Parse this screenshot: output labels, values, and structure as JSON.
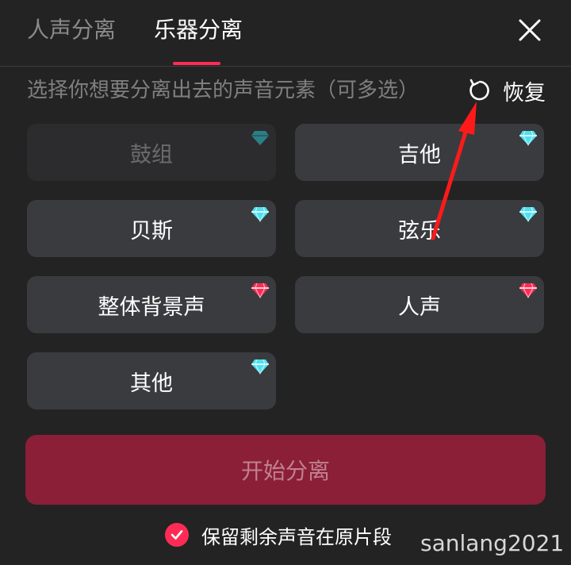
{
  "tabs": [
    {
      "label": "人声分离",
      "active": false
    },
    {
      "label": "乐器分离",
      "active": true
    }
  ],
  "hint": "选择你想要分离出去的声音元素（可多选）",
  "restore_label": "恢复",
  "options": [
    {
      "label": "鼓组",
      "enabled": false,
      "gem": "teal-diamond-icon"
    },
    {
      "label": "吉他",
      "enabled": true,
      "gem": "cyan-diamond-icon"
    },
    {
      "label": "贝斯",
      "enabled": true,
      "gem": "cyan-diamond-icon"
    },
    {
      "label": "弦乐",
      "enabled": true,
      "gem": "cyan-diamond-icon"
    },
    {
      "label": "整体背景声",
      "enabled": true,
      "gem": "pink-diamond-icon"
    },
    {
      "label": "人声",
      "enabled": true,
      "gem": "pink-diamond-icon"
    },
    {
      "label": "其他",
      "enabled": true,
      "gem": "cyan-diamond-icon"
    }
  ],
  "start_button": "开始分离",
  "keep_original": {
    "label": "保留剩余声音在原片段",
    "checked": true
  },
  "watermark": "sanlang2021",
  "colors": {
    "accent": "#fe2c55",
    "background": "#232323",
    "option_bg": "#3a3b3f",
    "start_button_bg": "#8a1f37",
    "gem_cyan": "#4fe0f0",
    "gem_pink": "#fe2c55"
  }
}
